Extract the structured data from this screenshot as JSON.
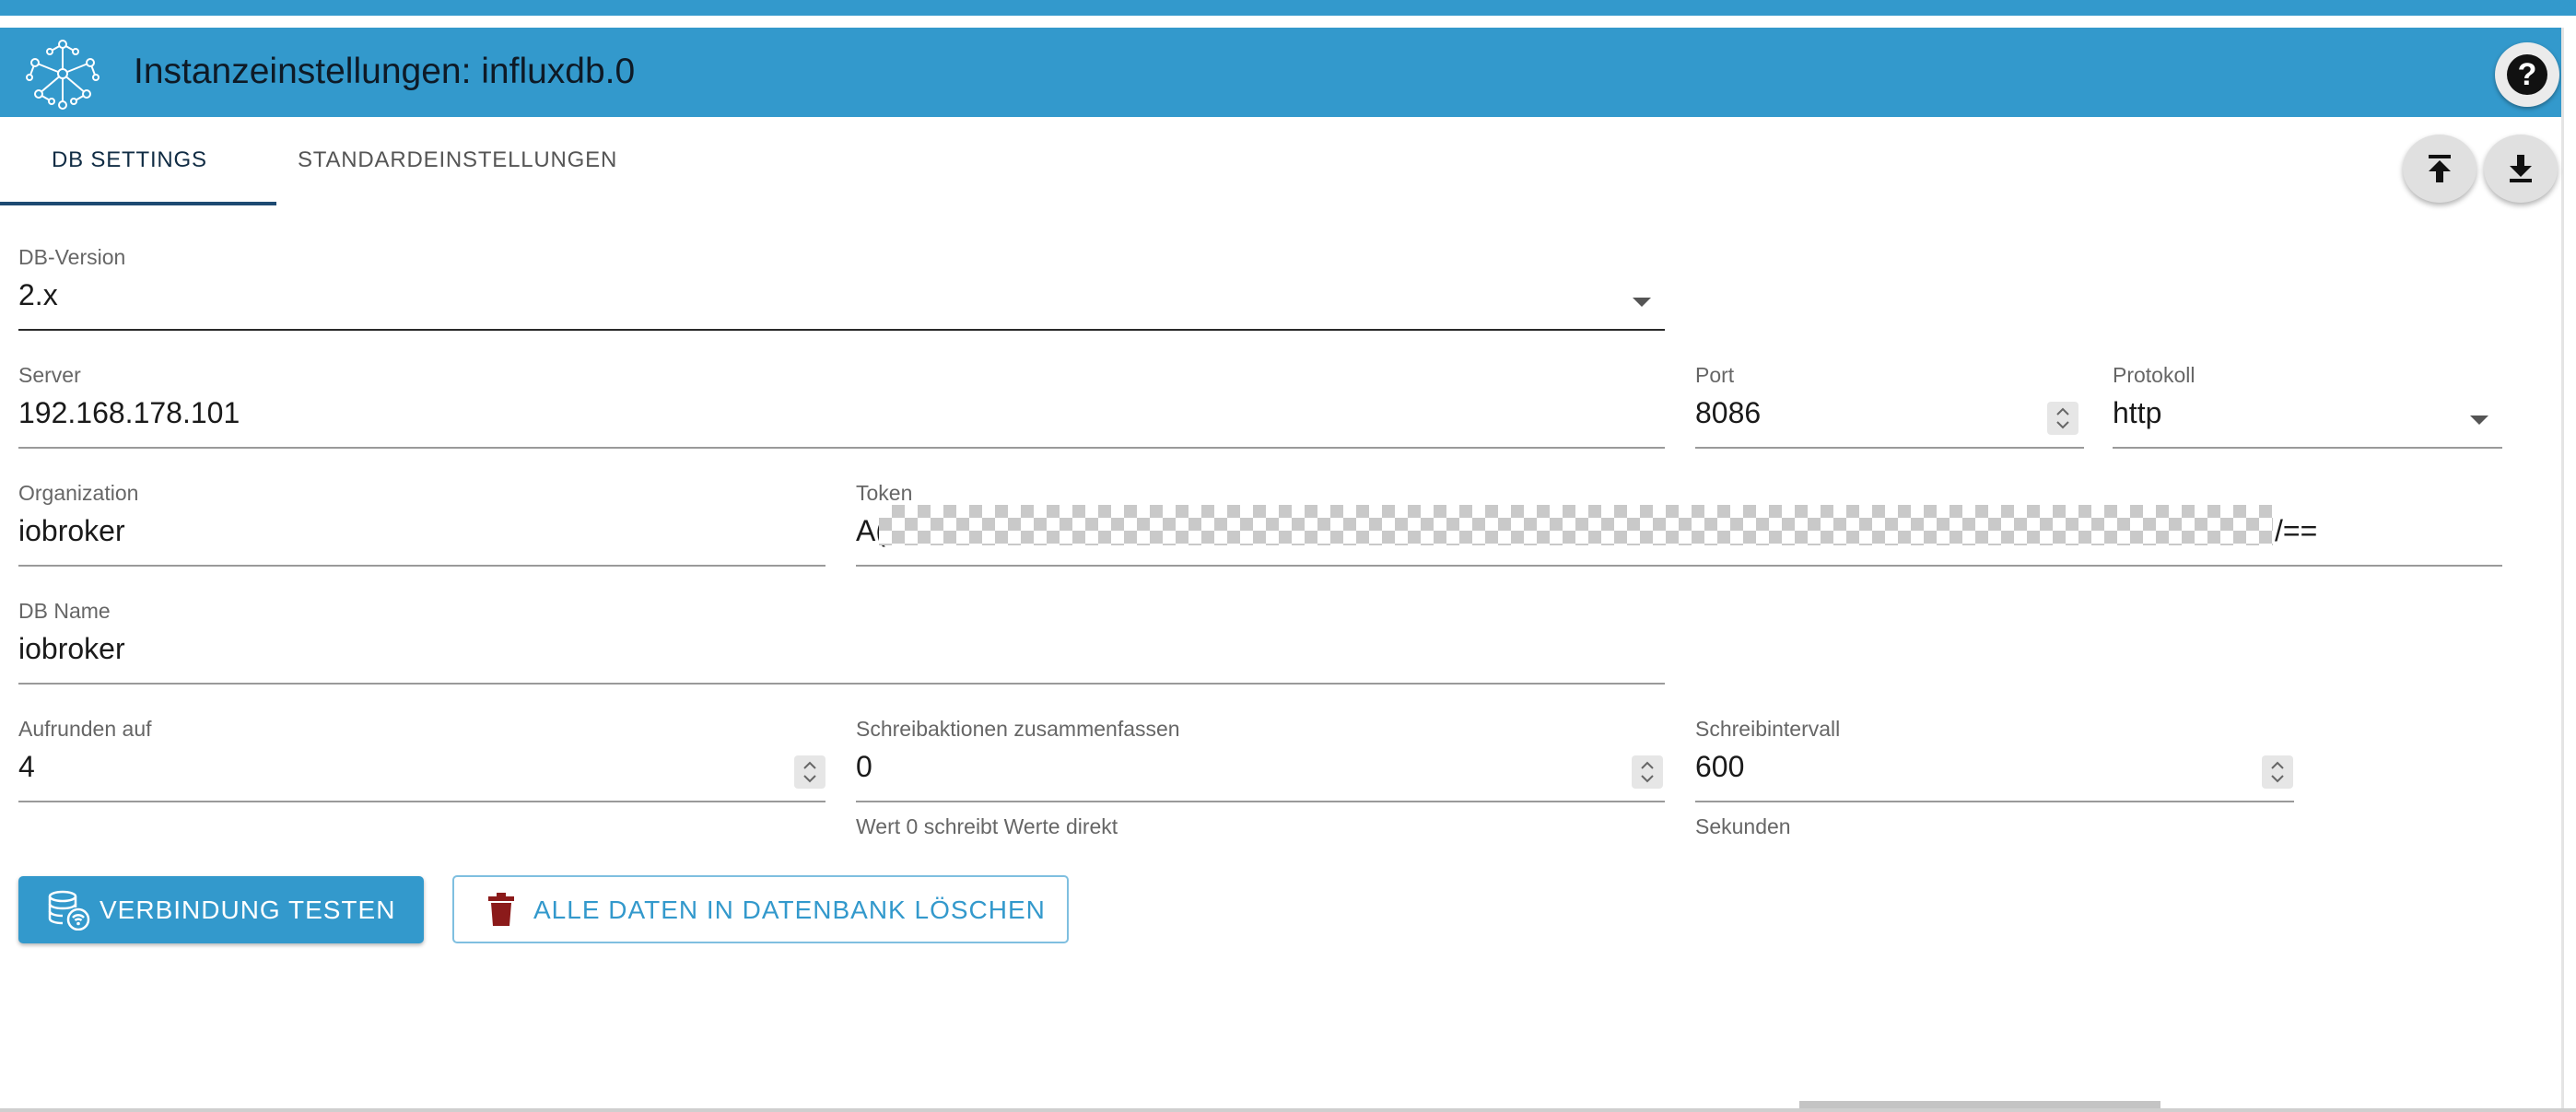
{
  "app": {
    "title": "Instanzeinstellungen: influxdb.0",
    "help_glyph": "?"
  },
  "colors": {
    "accent": "#3399cc",
    "tab_indicator": "#1d4a72",
    "danger_icon": "#8b1a1a"
  },
  "icons": {
    "logo": "influxdb-network-logo",
    "help": "help-icon",
    "upload": "upload-icon",
    "download": "download-icon",
    "select": "caret-down-icon",
    "number": "spinner-icon",
    "test": "database-wifi-icon",
    "delete": "trash-icon"
  },
  "tabs": [
    {
      "label": "DB SETTINGS",
      "active": true
    },
    {
      "label": "STANDARDEINSTELLUNGEN",
      "active": false
    }
  ],
  "fields": {
    "db_version": {
      "label": "DB-Version",
      "value": "2.x"
    },
    "server": {
      "label": "Server",
      "value": "192.168.178.101"
    },
    "port": {
      "label": "Port",
      "value": "8086"
    },
    "protokoll": {
      "label": "Protokoll",
      "value": "http"
    },
    "organization": {
      "label": "Organization",
      "value": "iobroker"
    },
    "token": {
      "label": "Token",
      "value_start": "A(",
      "value_end": "/=="
    },
    "db_name": {
      "label": "DB Name",
      "value": "iobroker"
    },
    "aufrunden": {
      "label": "Aufrunden auf",
      "value": "4"
    },
    "schreibaktionen": {
      "label": "Schreibaktionen zusammenfassen",
      "value": "0",
      "helper": "Wert 0 schreibt Werte direkt"
    },
    "schreibintervall": {
      "label": "Schreibintervall",
      "value": "600",
      "helper": "Sekunden"
    }
  },
  "buttons": {
    "test": {
      "label": "VERBINDUNG TESTEN"
    },
    "delete": {
      "label": "ALLE DATEN IN DATENBANK LÖSCHEN"
    }
  }
}
